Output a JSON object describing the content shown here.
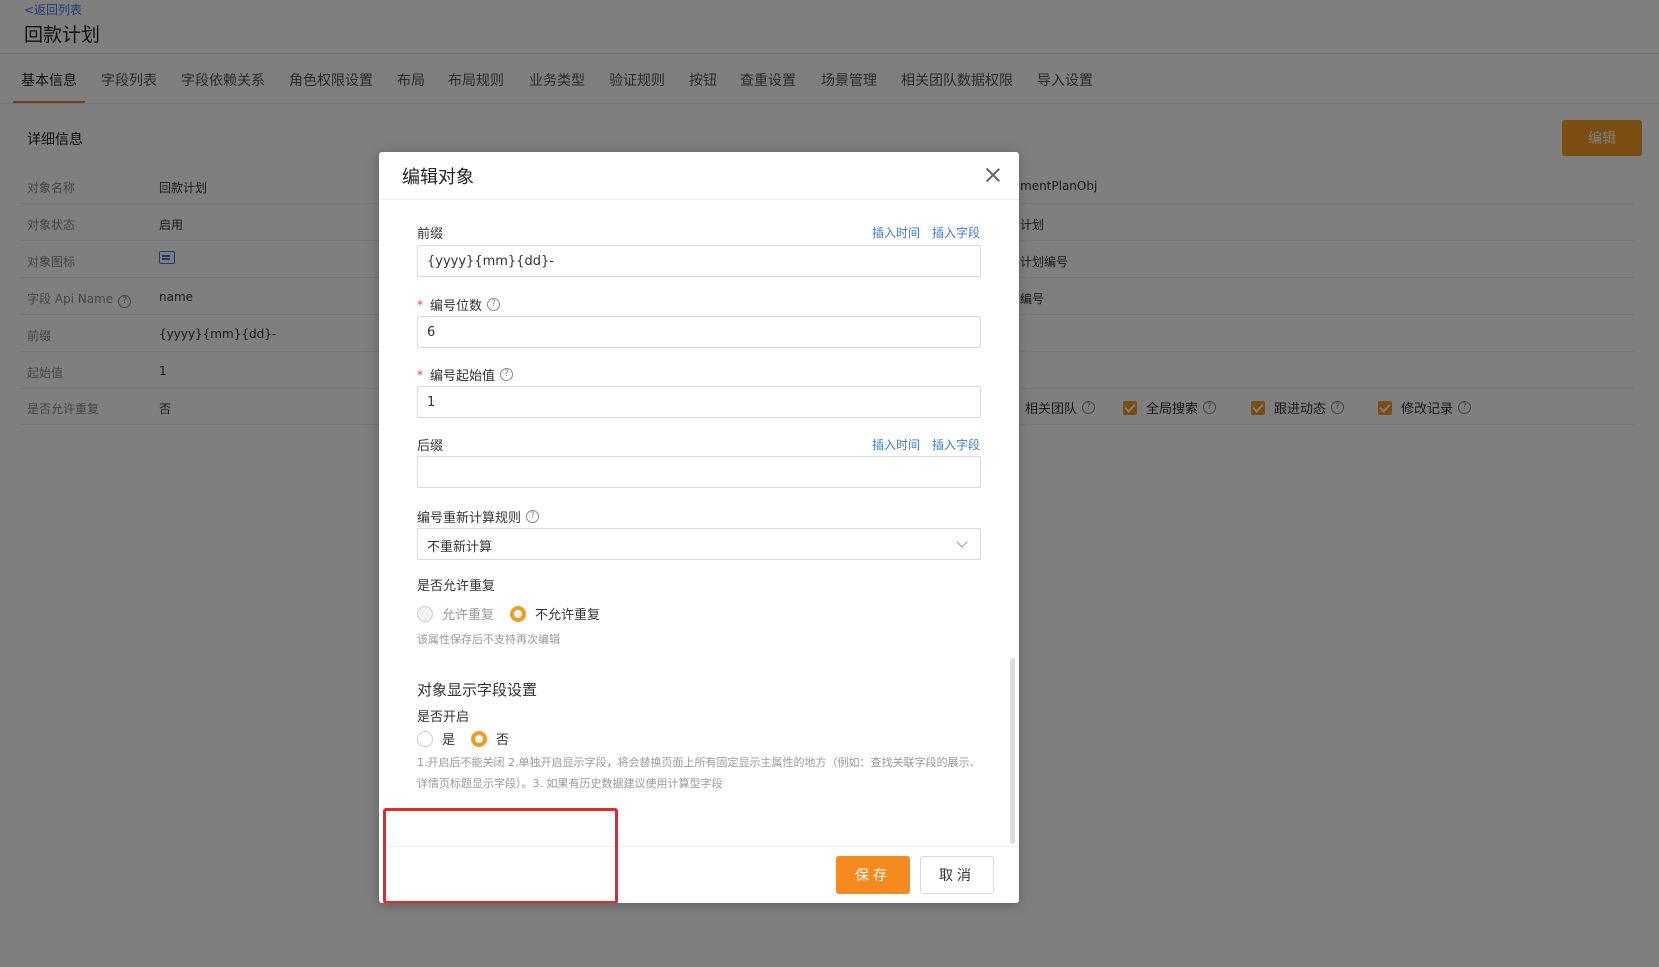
{
  "header": {
    "back_link": "<返回列表",
    "title": "回款计划"
  },
  "tabs": [
    {
      "label": "基本信息"
    },
    {
      "label": "字段列表"
    },
    {
      "label": "字段依赖关系"
    },
    {
      "label": "角色权限设置"
    },
    {
      "label": "布局"
    },
    {
      "label": "布局规则"
    },
    {
      "label": "业务类型"
    },
    {
      "label": "验证规则"
    },
    {
      "label": "按钮"
    },
    {
      "label": "查重设置"
    },
    {
      "label": "场景管理"
    },
    {
      "label": "相关团队数据权限"
    },
    {
      "label": "导入设置"
    }
  ],
  "details": {
    "section_title": "详细信息",
    "edit_label": "编辑",
    "rows": [
      {
        "label": "对象名称",
        "value": "回款计划",
        "right": "mentPlanObj"
      },
      {
        "label": "对象状态",
        "value": "启用",
        "right": "计划"
      },
      {
        "label": "对象图标",
        "value": "",
        "right": "计划编号"
      },
      {
        "label": "字段 Api Name",
        "value": "name",
        "right": "编号"
      },
      {
        "label": "前缀",
        "value": "{yyyy}{mm}{dd}-",
        "right": ""
      },
      {
        "label": "起始值",
        "value": "1",
        "right": ""
      },
      {
        "label": "是否允许重复",
        "value": "否",
        "right": ""
      }
    ],
    "checkboxes": [
      {
        "label": "相关团队"
      },
      {
        "label": "全局搜索"
      },
      {
        "label": "跟进动态"
      },
      {
        "label": "修改记录"
      }
    ]
  },
  "modal": {
    "title": "编辑对象",
    "prefix": {
      "label": "前缀",
      "value": "{yyyy}{mm}{dd}-",
      "insert_time": "插入时间",
      "insert_field": "插入字段"
    },
    "digits": {
      "label": "编号位数",
      "value": "6"
    },
    "start": {
      "label": "编号起始值",
      "value": "1"
    },
    "suffix": {
      "label": "后缀",
      "value": "",
      "insert_time": "插入时间",
      "insert_field": "插入字段"
    },
    "recalc": {
      "label": "编号重新计算规则",
      "value": "不重新计算"
    },
    "duplicate": {
      "label": "是否允许重复",
      "option_allow": "允许重复",
      "option_disallow": "不允许重复",
      "hint": "该属性保存后不支持再次编辑"
    },
    "display_field": {
      "title": "对象显示字段设置",
      "enable_label": "是否开启",
      "option_yes": "是",
      "option_no": "否",
      "hint": "1.开启后不能关闭 2.单独开启显示字段，将会替换页面上所有固定显示主属性的地方（例如：查找关联字段的展示、详情页标题显示字段）。3. 如果有历史数据建议使用计算型字段"
    },
    "save_label": "保存",
    "cancel_label": "取消"
  },
  "colors": {
    "accent": "#f59a23",
    "link": "#3d7ad6",
    "highlight_box": "#e8262a"
  }
}
